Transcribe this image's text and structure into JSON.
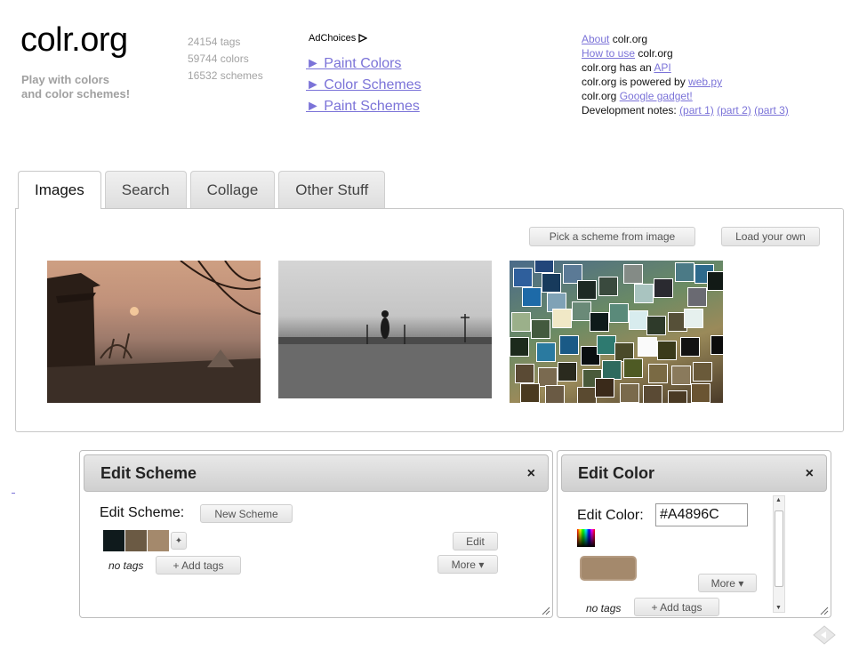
{
  "header": {
    "title": "colr.org",
    "tagline_1": "Play with colors",
    "tagline_2": "and color schemes!",
    "stats": [
      "24154 tags",
      "59744 colors",
      "16532 schemes"
    ],
    "ad_choices": "AdChoices",
    "nav": [
      "► Paint Colors",
      "► Color Schemes",
      "► Paint Schemes"
    ]
  },
  "info": {
    "about_link": "About",
    "about_suffix": " colr.org",
    "howto_link": "How to use",
    "howto_suffix": " colr.org",
    "api_prefix": "colr.org has an ",
    "api_link": "API",
    "powered_prefix": "colr.org is powered by ",
    "powered_link": "web.py",
    "gadget_prefix": "colr.org ",
    "gadget_link": "Google gadget!",
    "dev_prefix": "Development notes: ",
    "dev_links": [
      "(part 1)",
      "(part 2)",
      "(part 3)"
    ]
  },
  "tabs": [
    "Images",
    "Search",
    "Collage",
    "Other Stuff"
  ],
  "images_panel": {
    "pick_button": "Pick a scheme from image",
    "load_button": "Load your own"
  },
  "edit_scheme": {
    "header": "Edit Scheme",
    "close": "×",
    "label": "Edit Scheme:",
    "new_button": "New Scheme",
    "swatches": [
      "#0f1a1c",
      "#6b5a44",
      "#a4896c"
    ],
    "add_swatch": "✦",
    "no_tags": "no tags",
    "add_tags": "+ Add tags",
    "edit_button": "Edit",
    "more_button": "More ▾"
  },
  "edit_color": {
    "header": "Edit Color",
    "close": "×",
    "label": "Edit Color:",
    "hex_value": "#A4896C",
    "more_button": "More ▾",
    "no_tags": "no tags",
    "add_tags": "+ Add tags"
  }
}
